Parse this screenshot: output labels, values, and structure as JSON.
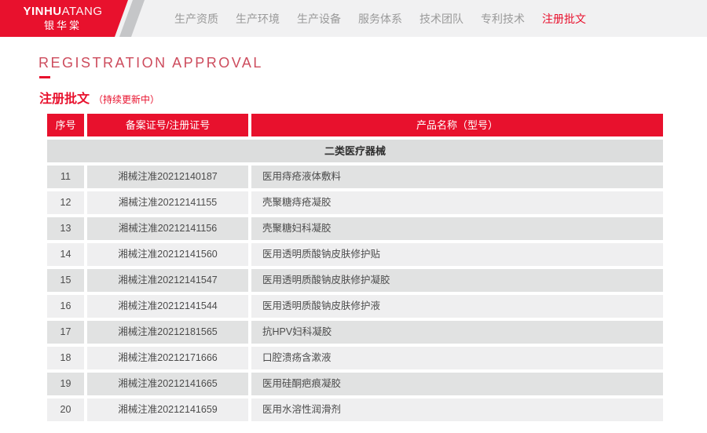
{
  "logo": {
    "brand_en_bold": "YINHU",
    "brand_en_light": "ATANG",
    "brand_cn": "银华棠"
  },
  "nav": {
    "items": [
      {
        "label": "生产资质",
        "active": false
      },
      {
        "label": "生产环境",
        "active": false
      },
      {
        "label": "生产设备",
        "active": false
      },
      {
        "label": "服务体系",
        "active": false
      },
      {
        "label": "技术团队",
        "active": false
      },
      {
        "label": "专利技术",
        "active": false
      },
      {
        "label": "注册批文",
        "active": true
      }
    ]
  },
  "page": {
    "title_en": "REGISTRATION APPROVAL",
    "title_cn": "注册批文",
    "title_note": "（持续更新中）"
  },
  "table": {
    "columns": [
      "序号",
      "备案证号/注册证号",
      "产品名称（型号）"
    ],
    "category": "二类医疗器械",
    "rows": [
      [
        "11",
        "湘械注准20212140187",
        "医用痔疮液体敷料"
      ],
      [
        "12",
        "湘械注准20212141155",
        "壳聚糖痔疮凝胶"
      ],
      [
        "13",
        "湘械注准20212141156",
        "壳聚糖妇科凝胶"
      ],
      [
        "14",
        "湘械注准20212141560",
        "医用透明质酸钠皮肤修护贴"
      ],
      [
        "15",
        "湘械注准20212141547",
        "医用透明质酸钠皮肤修护凝胶"
      ],
      [
        "16",
        "湘械注准20212141544",
        "医用透明质酸钠皮肤修护液"
      ],
      [
        "17",
        "湘械注准20212181565",
        "抗HPV妇科凝胶"
      ],
      [
        "18",
        "湘械注准20212171666",
        "口腔溃疡含漱液"
      ],
      [
        "19",
        "湘械注准20212141665",
        "医用硅酮疤痕凝胶"
      ],
      [
        "20",
        "湘械注准20212141659",
        "医用水溶性润滑剂"
      ]
    ]
  },
  "colors": {
    "accent_red": "#e8112d",
    "header_bg": "#f1f1f2",
    "row_dark": "#e1e2e2",
    "row_light": "#efeff0",
    "category_bg": "#dcdddd"
  }
}
